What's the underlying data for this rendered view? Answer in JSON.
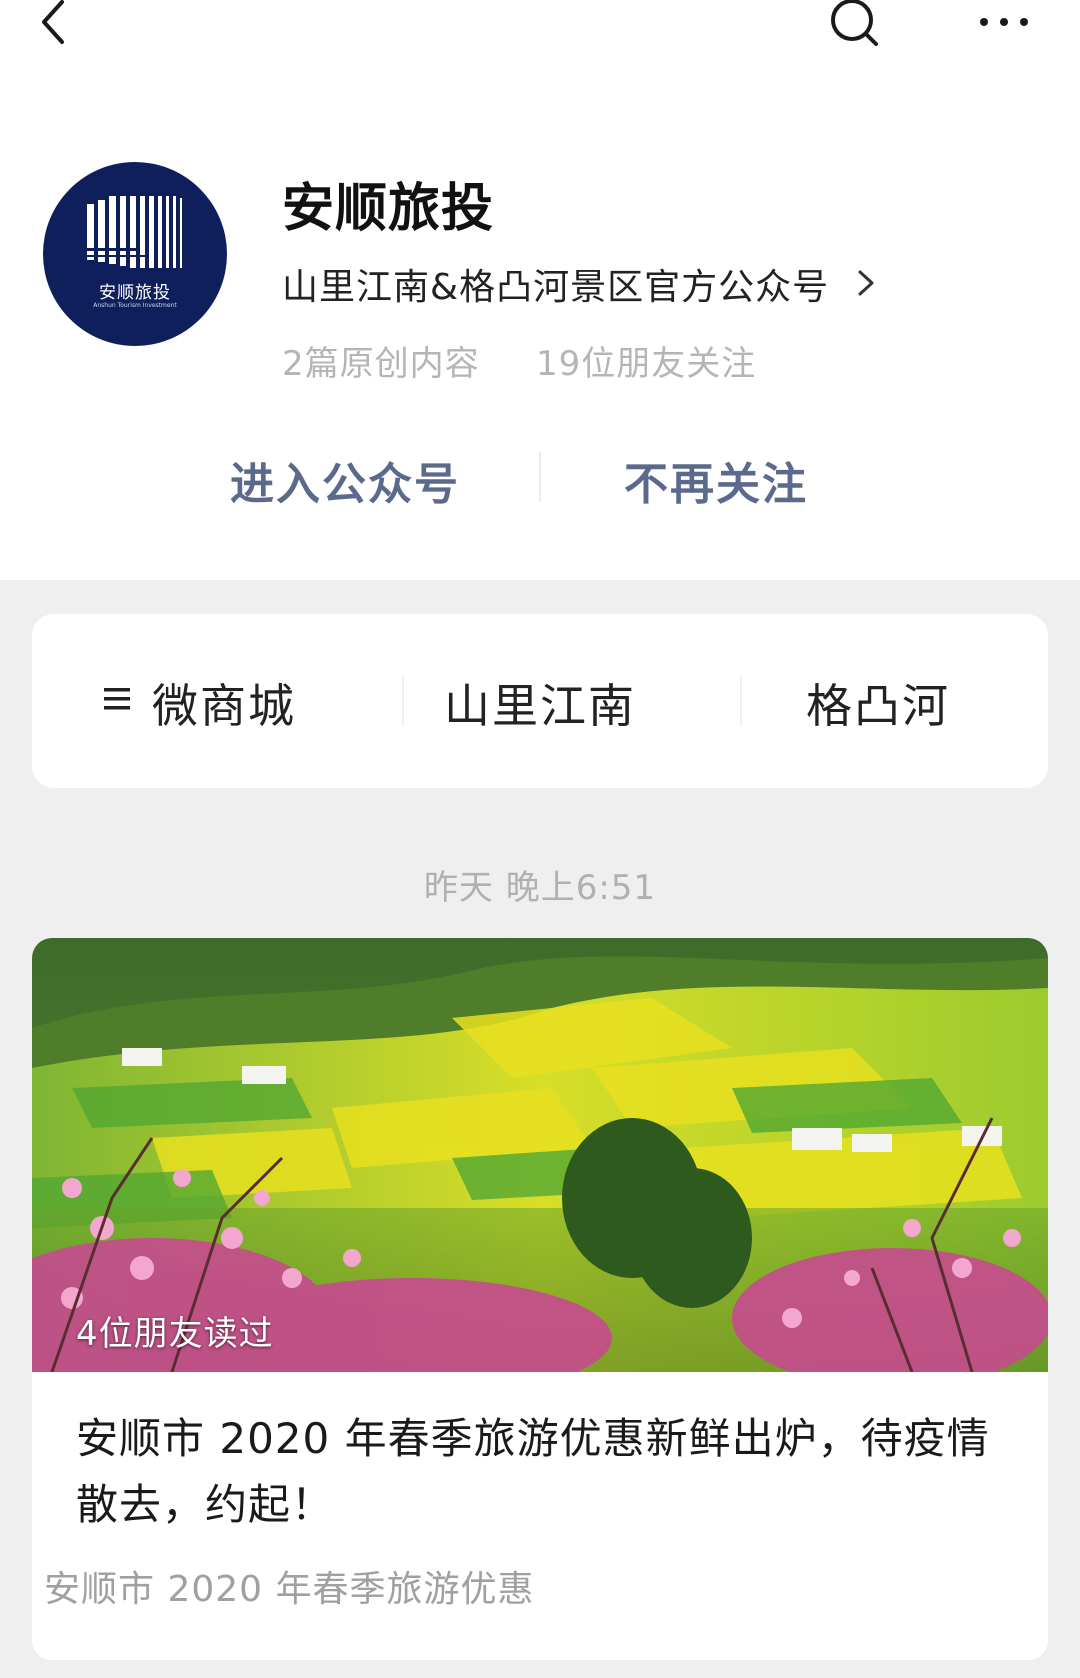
{
  "topbar": {
    "back_icon": "chevron-left-icon",
    "search_icon": "search-icon",
    "more_icon": "more-horizontal-icon"
  },
  "profile": {
    "avatar_logo_text": "安顺旅投",
    "avatar_logo_sub": "Anshun Tourism Investment",
    "name": "安顺旅投",
    "description": "山里江南&格凸河景区官方公众号",
    "original_count": "2篇原创内容",
    "friends_following": "19位朋友关注",
    "brand_color": "#0f1f5b"
  },
  "actions": {
    "enter_label": "进入公众号",
    "unfollow_label": "不再关注",
    "color": "#5b6a8c"
  },
  "menu": {
    "items": [
      {
        "label": "微商城",
        "icon": "hamburger-icon"
      },
      {
        "label": "山里江南"
      },
      {
        "label": "格凸河"
      }
    ]
  },
  "feed": {
    "timestamp": "昨天 晚上6:51",
    "article": {
      "read_by_friends": "4位朋友读过",
      "title": "安顺市 2020 年春季旅游优惠新鲜出炉，待疫情散去，约起！",
      "digest": "安顺市 2020 年春季旅游优惠"
    }
  }
}
